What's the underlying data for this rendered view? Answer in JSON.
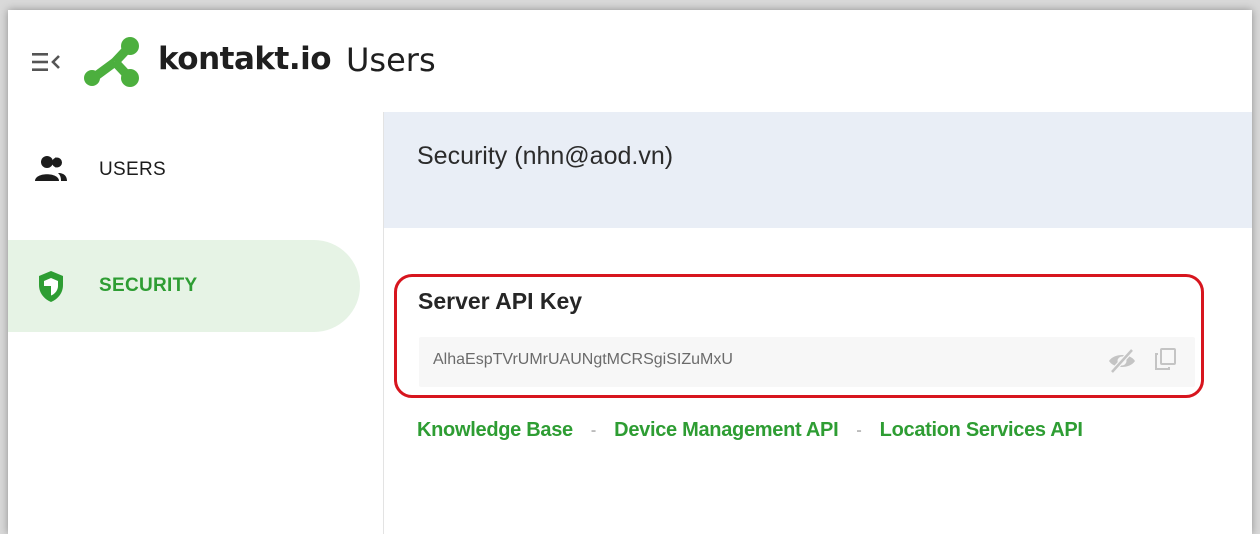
{
  "header": {
    "brand": "kontakt.io",
    "app_title": "Users",
    "brand_color": "#2e9d33"
  },
  "sidebar": {
    "items": [
      {
        "label": "USERS",
        "icon": "users-icon",
        "active": false
      },
      {
        "label": "SECURITY",
        "icon": "shield-icon",
        "active": true
      }
    ]
  },
  "main": {
    "title": "Security (nhn@aod.vn)",
    "api_key": {
      "label": "Server API Key",
      "value": "AlhaEspTVrUMrUAUNgtMCRSgiSIZuMxU"
    },
    "links": [
      {
        "label": "Knowledge Base"
      },
      {
        "label": "Device Management API"
      },
      {
        "label": "Location Services API"
      }
    ],
    "link_separator": "-"
  },
  "colors": {
    "active_nav_bg": "#e6f3e5",
    "header_bg": "#e9eef6",
    "highlight_border": "#d7151e"
  }
}
